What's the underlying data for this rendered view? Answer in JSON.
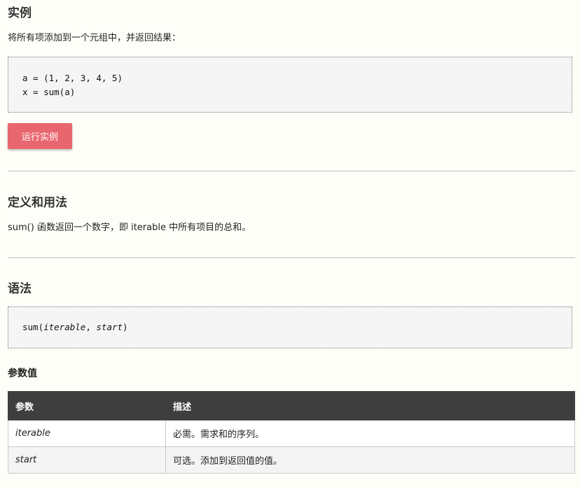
{
  "example": {
    "heading": "实例",
    "description": "将所有项添加到一个元组中，并返回结果：",
    "code_lines": [
      "a = (1, 2, 3, 4, 5)",
      "x = sum(a)"
    ],
    "run_button": "运行实例"
  },
  "definition": {
    "heading": "定义和用法",
    "description": "sum() 函数返回一个数字，即 iterable 中所有项目的总和。"
  },
  "syntax": {
    "heading": "语法",
    "code_prefix": "sum(",
    "arg1": "iterable",
    "sep": ", ",
    "arg2": "start",
    "code_suffix": ")"
  },
  "parameters": {
    "heading": "参数值",
    "columns": [
      "参数",
      "描述"
    ],
    "rows": [
      {
        "name": "iterable",
        "desc": "必需。需求和的序列。"
      },
      {
        "name": "start",
        "desc": "可选。添加到返回值的值。"
      }
    ]
  },
  "colors": {
    "run_button": "#e8676f",
    "table_header": "#3e3e3e",
    "code_bg": "#f5f5f5",
    "page_bg": "#fefef9"
  }
}
